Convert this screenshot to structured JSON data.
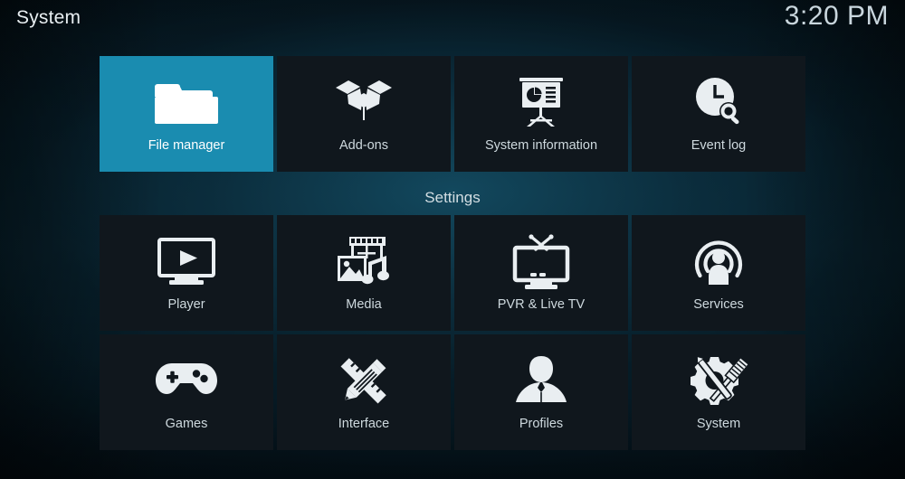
{
  "header": {
    "title": "System",
    "clock": "3:20 PM"
  },
  "colors": {
    "selected_tile": "#1a8cb0",
    "tile_background": "#10171d",
    "icon": "#e9eef1",
    "label": "#ced9de",
    "background_teal": "#0a2b3a"
  },
  "top_row": {
    "tiles": [
      {
        "label": "File manager",
        "icon": "folder-icon",
        "selected": true
      },
      {
        "label": "Add-ons",
        "icon": "open-box-icon",
        "selected": false
      },
      {
        "label": "System information",
        "icon": "presentation-chart-icon",
        "selected": false
      },
      {
        "label": "Event log",
        "icon": "clock-search-icon",
        "selected": false
      }
    ]
  },
  "settings_section": {
    "heading": "Settings",
    "tiles": [
      {
        "label": "Player",
        "icon": "monitor-play-icon",
        "selected": false
      },
      {
        "label": "Media",
        "icon": "filmstrip-photo-music-icon",
        "selected": false
      },
      {
        "label": "PVR & Live TV",
        "icon": "tv-antenna-icon",
        "selected": false
      },
      {
        "label": "Services",
        "icon": "broadcast-person-icon",
        "selected": false
      },
      {
        "label": "Games",
        "icon": "gamepad-icon",
        "selected": false
      },
      {
        "label": "Interface",
        "icon": "pencil-ruler-icon",
        "selected": false
      },
      {
        "label": "Profiles",
        "icon": "person-bust-icon",
        "selected": false
      },
      {
        "label": "System",
        "icon": "gears-tools-icon",
        "selected": false
      }
    ]
  }
}
